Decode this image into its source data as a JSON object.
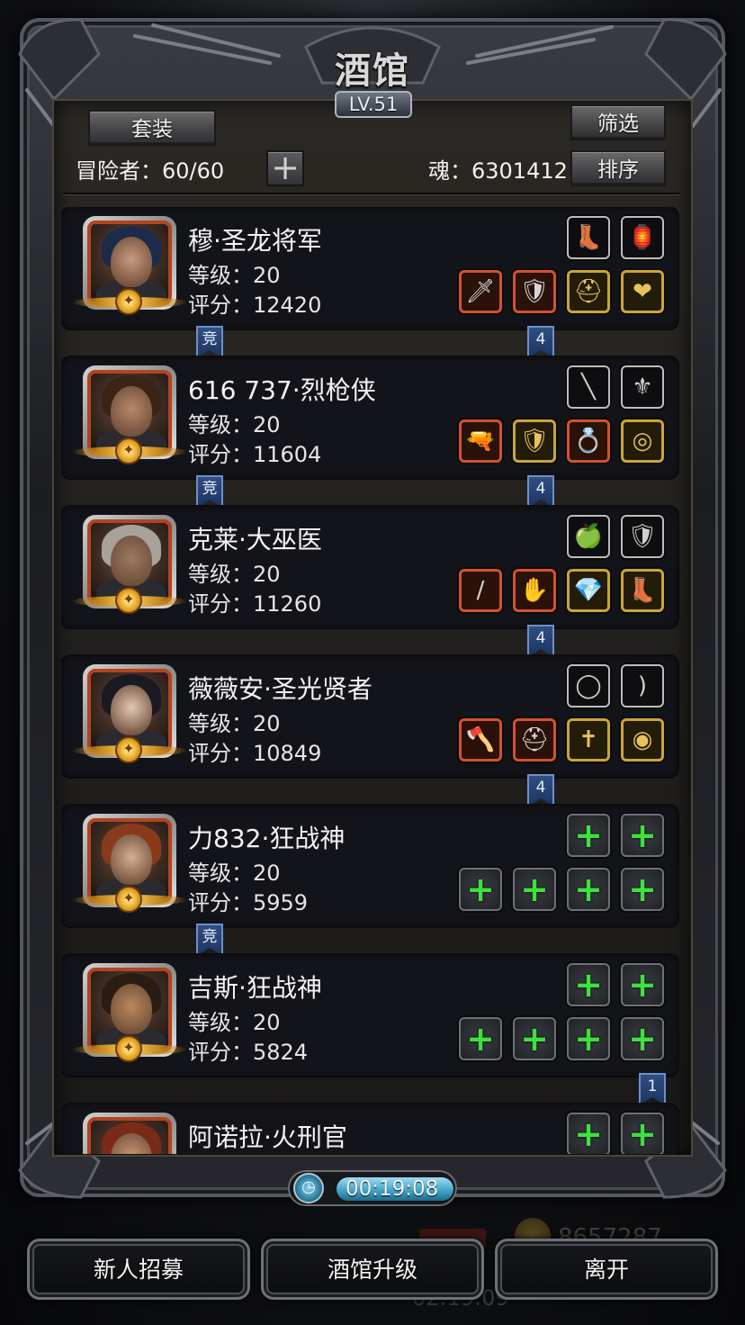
{
  "title": "酒馆",
  "level_badge": "LV.51",
  "header": {
    "set_button": "套装",
    "filter_button": "筛选",
    "sort_button": "排序",
    "adventurers": "冒险者：60/60",
    "add_icon": "plus-icon",
    "soul": "魂：6301412"
  },
  "heroes": [
    {
      "name": "穆·圣龙将军",
      "level": "等级：20",
      "score": "评分：12420",
      "portrait_hair": "#1c2b4a",
      "portrait_skin": "#c89a80",
      "top_slots": [
        {
          "style": "black",
          "icon": "boots-icon",
          "glyph": "👢"
        },
        {
          "style": "black",
          "icon": "lantern-icon",
          "glyph": "🏮"
        }
      ],
      "bottom_slots": [
        {
          "style": "orange",
          "icon": "sword-icon",
          "glyph": "🗡"
        },
        {
          "style": "orange",
          "icon": "armor-icon",
          "glyph": "🛡"
        },
        {
          "style": "gold",
          "icon": "helmet-icon",
          "glyph": "⛑"
        },
        {
          "style": "gold",
          "icon": "amulet-icon",
          "glyph": "❤"
        }
      ],
      "tag_left": "竞",
      "tag_right": "4"
    },
    {
      "name": "616 737·烈枪侠",
      "level": "等级：20",
      "score": "评分：11604",
      "portrait_hair": "#3b2416",
      "portrait_skin": "#b8876a",
      "top_slots": [
        {
          "style": "black",
          "icon": "staff-icon",
          "glyph": "╲"
        },
        {
          "style": "black",
          "icon": "crest-icon",
          "glyph": "⚜"
        }
      ],
      "bottom_slots": [
        {
          "style": "orange",
          "icon": "gun-icon",
          "glyph": "🔫"
        },
        {
          "style": "gold",
          "icon": "chestplate-icon",
          "glyph": "🛡"
        },
        {
          "style": "orange",
          "icon": "ring-icon",
          "glyph": "💍"
        },
        {
          "style": "gold",
          "icon": "bracelet-icon",
          "glyph": "◎"
        }
      ],
      "tag_left": "竞",
      "tag_right": "4"
    },
    {
      "name": "克莱·大巫医",
      "level": "等级：20",
      "score": "评分：11260",
      "portrait_hair": "#a8a29a",
      "portrait_skin": "#9a7a62",
      "top_slots": [
        {
          "style": "black",
          "icon": "apple-icon",
          "glyph": "🍏"
        },
        {
          "style": "black",
          "icon": "shield-icon",
          "glyph": "🛡"
        }
      ],
      "bottom_slots": [
        {
          "style": "orange",
          "icon": "wand-icon",
          "glyph": "/"
        },
        {
          "style": "orange",
          "icon": "glove-icon",
          "glyph": "✋"
        },
        {
          "style": "gold",
          "icon": "gem-icon",
          "glyph": "💎"
        },
        {
          "style": "gold",
          "icon": "boots-icon",
          "glyph": "👢"
        }
      ],
      "tag_left": "",
      "tag_right": "4"
    },
    {
      "name": "薇薇安·圣光贤者",
      "level": "等级：20",
      "score": "评分：10849",
      "portrait_hair": "#1a1a22",
      "portrait_skin": "#e2c7b5",
      "top_slots": [
        {
          "style": "black",
          "icon": "belt-icon",
          "glyph": "◯"
        },
        {
          "style": "black",
          "icon": "bow-icon",
          "glyph": ")"
        }
      ],
      "bottom_slots": [
        {
          "style": "orange",
          "icon": "axe-icon",
          "glyph": "🪓"
        },
        {
          "style": "orange",
          "icon": "helmet-icon",
          "glyph": "⛑"
        },
        {
          "style": "gold",
          "icon": "cross-icon",
          "glyph": "✝"
        },
        {
          "style": "gold",
          "icon": "ring-icon",
          "glyph": "◉"
        }
      ],
      "tag_left": "",
      "tag_right": "4"
    },
    {
      "name": "力832·狂战神",
      "level": "等级：20",
      "score": "评分：5959",
      "portrait_hair": "#8a3a1c",
      "portrait_skin": "#d6ae92",
      "top_slots": [
        {
          "style": "empty",
          "icon": "plus-icon",
          "glyph": "+"
        },
        {
          "style": "empty",
          "icon": "plus-icon",
          "glyph": "+"
        }
      ],
      "bottom_slots": [
        {
          "style": "empty",
          "icon": "plus-icon",
          "glyph": "+"
        },
        {
          "style": "empty",
          "icon": "plus-icon",
          "glyph": "+"
        },
        {
          "style": "empty",
          "icon": "plus-icon",
          "glyph": "+"
        },
        {
          "style": "empty",
          "icon": "plus-icon",
          "glyph": "+"
        }
      ],
      "tag_left": "竞",
      "tag_right": ""
    },
    {
      "name": "吉斯·狂战神",
      "level": "等级：20",
      "score": "评分：5824",
      "portrait_hair": "#2b1c12",
      "portrait_skin": "#b9885f",
      "top_slots": [
        {
          "style": "empty",
          "icon": "plus-icon",
          "glyph": "+"
        },
        {
          "style": "empty",
          "icon": "plus-icon",
          "glyph": "+"
        }
      ],
      "bottom_slots": [
        {
          "style": "empty",
          "icon": "plus-icon",
          "glyph": "+"
        },
        {
          "style": "empty",
          "icon": "plus-icon",
          "glyph": "+"
        },
        {
          "style": "empty",
          "icon": "plus-icon",
          "glyph": "+"
        },
        {
          "style": "empty",
          "icon": "plus-icon",
          "glyph": "+"
        }
      ],
      "tag_left": "",
      "tag_right": "1"
    },
    {
      "name": "阿诺拉·火刑官",
      "level": "",
      "score": "",
      "portrait_hair": "#7a2a18",
      "portrait_skin": "#c99576",
      "top_slots": [
        {
          "style": "empty",
          "icon": "plus-icon",
          "glyph": "+"
        },
        {
          "style": "empty",
          "icon": "plus-icon",
          "glyph": "+"
        }
      ],
      "bottom_slots": [],
      "tag_left": "",
      "tag_right": ""
    }
  ],
  "timer": "00:19:08",
  "background_hud": {
    "gold": "8657287",
    "time": "02:19:09"
  },
  "bottom_buttons": {
    "recruit": "新人招募",
    "upgrade": "酒馆升级",
    "leave": "离开"
  }
}
